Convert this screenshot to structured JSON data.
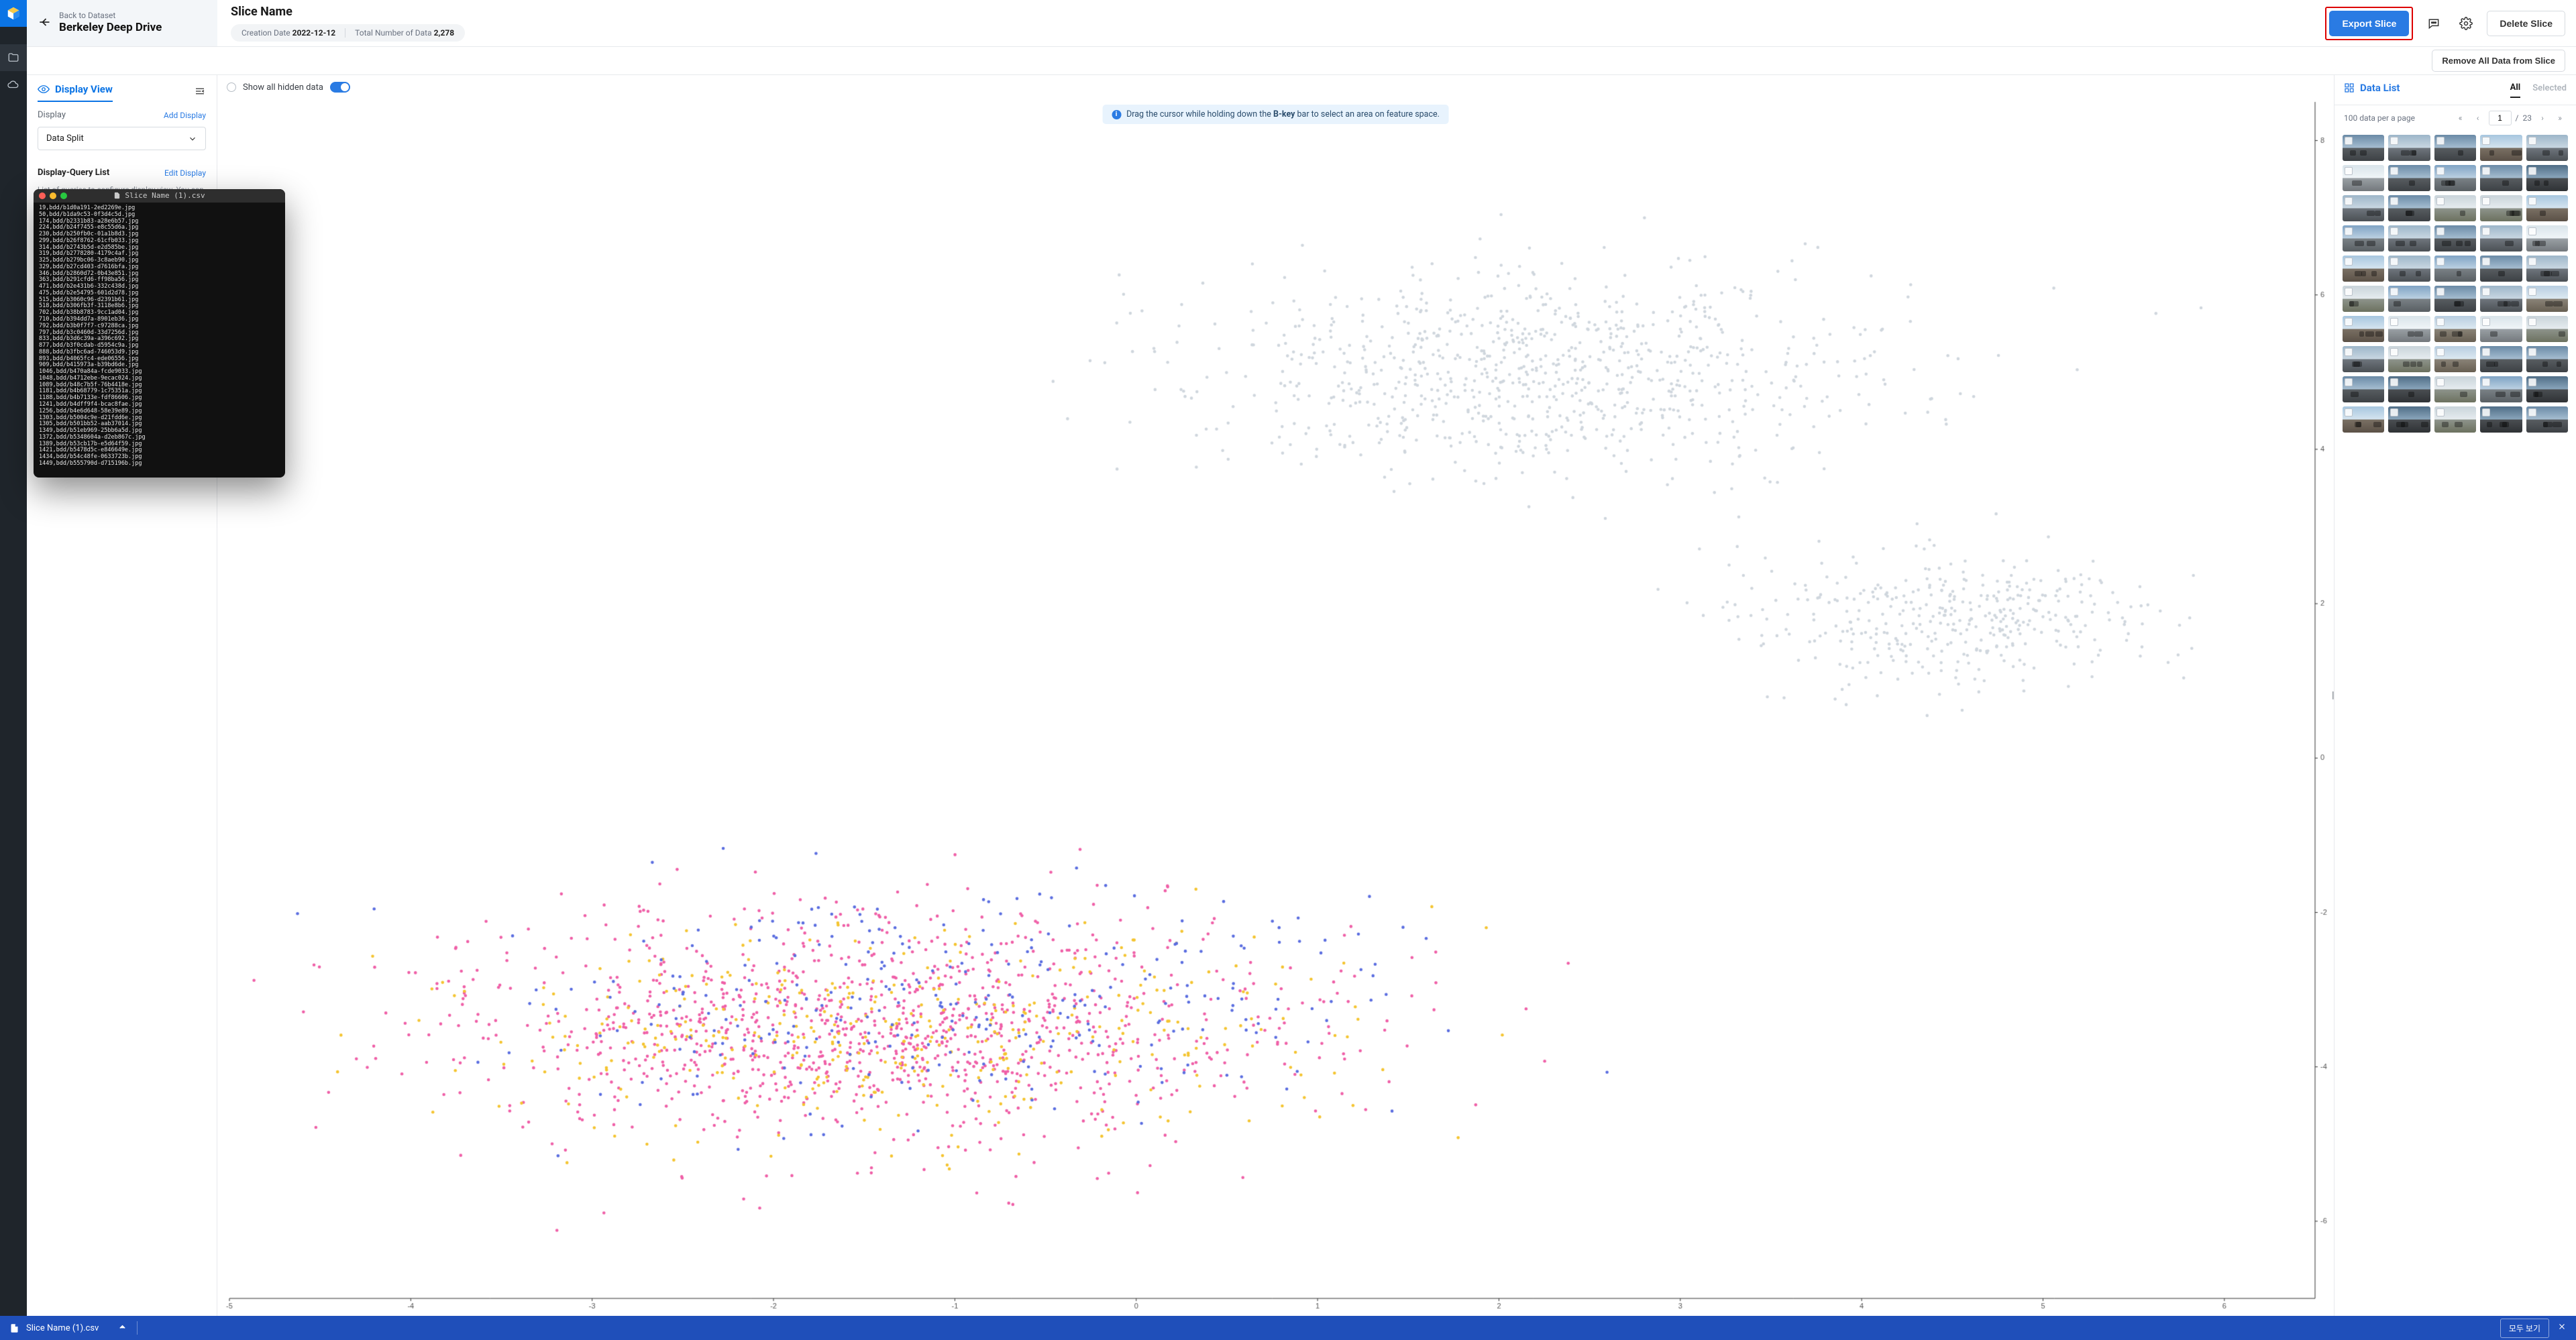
{
  "nav": {
    "back_label": "Back to Dataset",
    "dataset_name": "Berkeley Deep Drive"
  },
  "slice": {
    "title": "Slice Name",
    "creation_label": "Creation Date",
    "creation_value": "2022-12-12",
    "total_label": "Total Number of Data",
    "total_value": "2,278"
  },
  "actions": {
    "export": "Export Slice",
    "delete": "Delete Slice",
    "remove_all": "Remove All Data from Slice"
  },
  "side": {
    "tab": "Display View",
    "display_label": "Display",
    "add_display": "Add Display",
    "dropdown_value": "Data Split",
    "dq_title": "Display-Query List",
    "edit_display": "Edit Display",
    "dq_sub": "List of queries to configure display view. You can add and manage queries"
  },
  "center": {
    "show_hidden": "Show all hidden data",
    "hint_pre": "Drag the cursor while holding down the ",
    "hint_key": "B-key",
    "hint_post": " bar to select an area on feature space."
  },
  "chart_data": {
    "type": "scatter",
    "xlim": [
      -5,
      6.5
    ],
    "ylim": [
      -7,
      8.5
    ],
    "x_ticks": [
      -5,
      -4,
      -3,
      -2,
      -1,
      0,
      1,
      2,
      3,
      4,
      5,
      6
    ],
    "y_ticks": [
      -6,
      -4,
      -2,
      0,
      2,
      4,
      6,
      8
    ],
    "clusters": [
      {
        "color": "#cfd6dd",
        "n": 900,
        "cx": 2.2,
        "cy": 5.0,
        "rx": 2.8,
        "ry": 2.0
      },
      {
        "color": "#cfd6dd",
        "n": 400,
        "cx": 4.5,
        "cy": 1.8,
        "rx": 1.6,
        "ry": 1.2
      },
      {
        "color": "#ef5fa7",
        "n": 1200,
        "cx": -1.5,
        "cy": -3.5,
        "rx": 3.4,
        "ry": 2.2
      },
      {
        "color": "#f4c430",
        "n": 420,
        "cx": -1.3,
        "cy": -3.6,
        "rx": 3.2,
        "ry": 2.0
      },
      {
        "color": "#5a6de0",
        "n": 320,
        "cx": -1.0,
        "cy": -3.2,
        "rx": 3.3,
        "ry": 2.1
      }
    ]
  },
  "right": {
    "tab_main": "Data List",
    "tab_all": "All",
    "tab_selected": "Selected",
    "per_page": "100 data per a page",
    "page_current": "1",
    "page_total": "23"
  },
  "terminal": {
    "title": "Slice Name (1).csv",
    "lines": [
      "19,bdd/b1d0a191-2ed2269e.jpg",
      "50,bdd/b1da9c53-0f3d4c5d.jpg",
      "174,bdd/b2331b83-a28e6b57.jpg",
      "224,bdd/b24f7455-e8c55d6a.jpg",
      "230,bdd/b250fb0c-01a1b8d3.jpg",
      "299,bdd/b26f8762-61cfb033.jpg",
      "314,bdd/b2743b5d-e2d585be.jpg",
      "319,bdd/b2778280-4179c4af.jpg",
      "325,bdd/b279bc06-3c8aeb90.jpg",
      "329,bdd/b27cd403-d7616bfa.jpg",
      "346,bdd/b2860d72-0b43e851.jpg",
      "363,bdd/b291cfd6-ff98ba56.jpg",
      "471,bdd/b2e431b6-332c438d.jpg",
      "475,bdd/b2e54795-601d2d78.jpg",
      "515,bdd/b3060c96-d2391b61.jpg",
      "518,bdd/b306fb3f-3118e8b6.jpg",
      "702,bdd/b38b8783-9cc1ad04.jpg",
      "710,bdd/b394dd7a-8901eb36.jpg",
      "792,bdd/b3b0f7f7-c97288ca.jpg",
      "797,bdd/b3c0460d-33d7256d.jpg",
      "833,bdd/b3d6c39a-a396c692.jpg",
      "877,bdd/b3f0cdab-d5954c9a.jpg",
      "888,bdd/b3fbc6ad-746053d9.jpg",
      "893,bdd/b4065fc4-ede06556.jpg",
      "909,bdd/b415973a-b39bd6de.jpg",
      "1046,bdd/b470a84a-fcde9033.jpg",
      "1048,bdd/b4712ebe-9ecac024.jpg",
      "1089,bdd/b48c7b5f-76b4418e.jpg",
      "1181,bdd/b4b68779-1c75351a.jpg",
      "1188,bdd/b4b7133e-fdf86606.jpg",
      "1241,bdd/b4dff9f4-bcac8fae.jpg",
      "1256,bdd/b4e6d648-58e39e89.jpg",
      "1303,bdd/b5004c9e-d21fdd6e.jpg",
      "1305,bdd/b501bb52-aab37014.jpg",
      "1349,bdd/b51eb969-25bb6a5d.jpg",
      "1372,bdd/b5348604a-d2eb867c.jpg",
      "1389,bdd/b53cb17b-e5d64f59.jpg",
      "1421,bdd/b5478d5c-e846649e.jpg",
      "1434,bdd/b54c48fe-0633723b.jpg",
      "1449,bdd/b555790d-d715196b.jpg"
    ]
  },
  "download": {
    "file": "Slice Name (1).csv",
    "view_all": "모두 보기"
  },
  "thumbs": {
    "rows": 10,
    "cols": 5,
    "palettes": [
      [
        "#9db6c9",
        "#c9d7e2",
        "#6f767d",
        "#4b5055"
      ],
      [
        "#7fa3c4",
        "#bcd1e2",
        "#7a8186",
        "#595f63"
      ],
      [
        "#c9d4da",
        "#e6ecef",
        "#8e948c",
        "#6c715f"
      ],
      [
        "#6a8aa6",
        "#a6bed1",
        "#585d61",
        "#3d4145"
      ],
      [
        "#a7c6df",
        "#d5e4ef",
        "#7a7064",
        "#5b5147"
      ],
      [
        "#d9e4ea",
        "#f0f5f8",
        "#9aa0a5",
        "#73787c"
      ],
      [
        "#4f6d86",
        "#8aa6bc",
        "#4a4e52",
        "#2f3235"
      ],
      [
        "#b7cde0",
        "#dde9f1",
        "#8a8378",
        "#675f52"
      ]
    ]
  }
}
